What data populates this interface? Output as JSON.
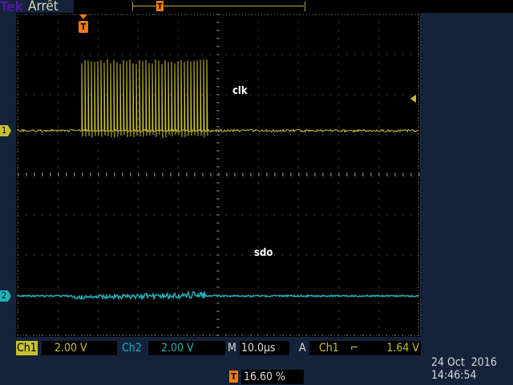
{
  "header": {
    "logo": "Tek",
    "state": "Arrêt"
  },
  "waveforms": {
    "ch1_label": "clk",
    "ch2_label": "sdo",
    "ch1_marker": "1",
    "ch2_marker": "2"
  },
  "status": {
    "ch1_name": "Ch1",
    "ch1_scale": "2.00 V",
    "ch2_name": "Ch2",
    "ch2_scale": "2.00 V",
    "time_prefix": "M",
    "timebase": "10.0µs",
    "trigger_prefix": "A",
    "trigger_source": "Ch1",
    "trigger_slope": "⌐",
    "trigger_level": "1.64 V",
    "trigger_position": "16.60 %",
    "trigger_icon": "T"
  },
  "datetime": {
    "date": "24 Oct  2016",
    "time": "14:46:54"
  },
  "colors": {
    "ch1": "#c8c030",
    "ch2": "#20b0b8",
    "trigger": "#f07a10"
  }
}
